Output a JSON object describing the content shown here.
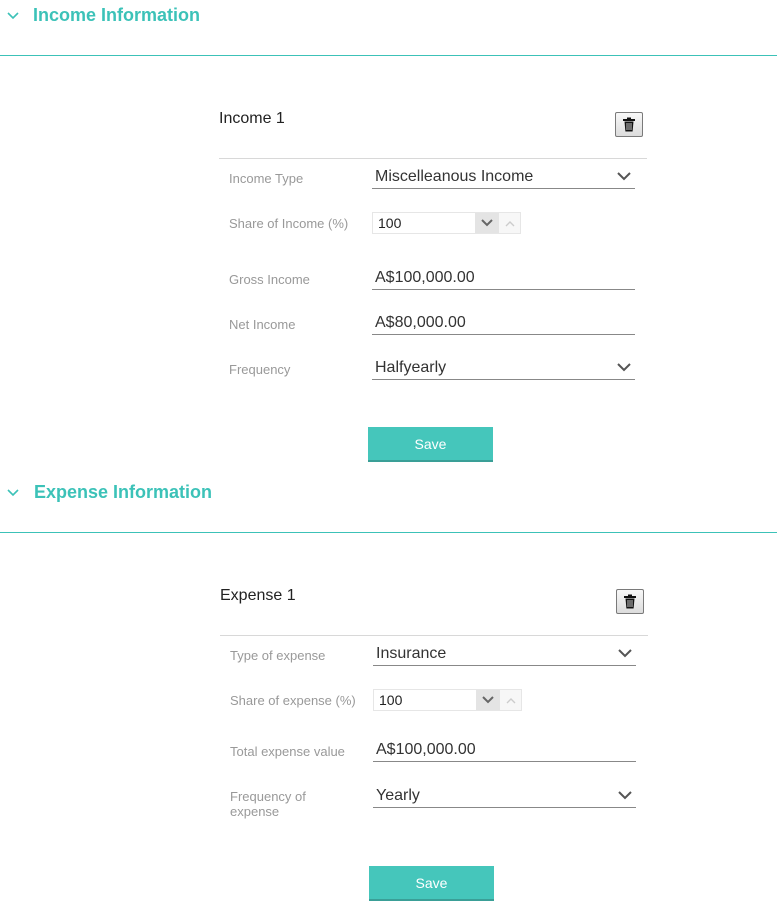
{
  "income": {
    "section_title": "Income Information",
    "card_title": "Income 1",
    "fields": {
      "type": {
        "label": "Income Type",
        "value": "Miscelleanous Income"
      },
      "share": {
        "label": "Share of Income (%)",
        "value": "100"
      },
      "gross": {
        "label": "Gross Income",
        "value": "A$100,000.00"
      },
      "net": {
        "label": "Net Income",
        "value": "A$80,000.00"
      },
      "frequency": {
        "label": "Frequency",
        "value": "Halfyearly"
      }
    },
    "save_label": "Save"
  },
  "expense": {
    "section_title": "Expense Information",
    "card_title": "Expense 1",
    "fields": {
      "type": {
        "label": "Type of expense",
        "value": "Insurance"
      },
      "share": {
        "label": "Share of expense (%)",
        "value": "100"
      },
      "total": {
        "label": "Total expense value",
        "value": "A$100,000.00"
      },
      "frequency": {
        "label": "Frequency of expense",
        "value": "Yearly"
      }
    },
    "save_label": "Save"
  },
  "colors": {
    "accent": "#3cc2b8",
    "button": "#45c6bb",
    "label": "#999999"
  },
  "icons": {
    "collapse": "chevron-down-icon",
    "delete": "trash-icon",
    "dropdown": "chevron-down-icon"
  }
}
